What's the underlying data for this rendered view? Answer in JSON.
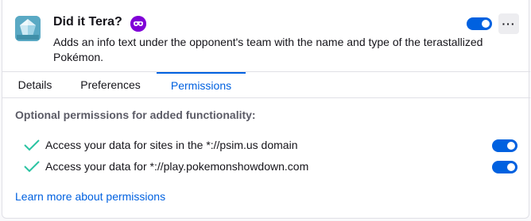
{
  "addon": {
    "name": "Did it Tera?",
    "description": "Adds an info text under the opponent's team with the name and type of the terastallized Pokémon.",
    "icon": "diamond-tera-icon",
    "enabled": true,
    "private_browsing_badge": "private-browsing-icon",
    "more_button": "more-options-icon"
  },
  "tabs": [
    {
      "label": "Details",
      "selected": false
    },
    {
      "label": "Preferences",
      "selected": false
    },
    {
      "label": "Permissions",
      "selected": true
    }
  ],
  "permissions": {
    "heading": "Optional permissions for added functionality:",
    "items": [
      {
        "label": "Access your data for sites in the *://psim.us domain",
        "enabled": true
      },
      {
        "label": "Access your data for *://play.pokemonshowdown.com",
        "enabled": true
      }
    ],
    "learn_more": "Learn more about permissions"
  },
  "colors": {
    "accent": "#0061e0",
    "check": "#2ac3a2",
    "private_badge": "#8000d7",
    "icon_bg": "#5aa9c4"
  }
}
